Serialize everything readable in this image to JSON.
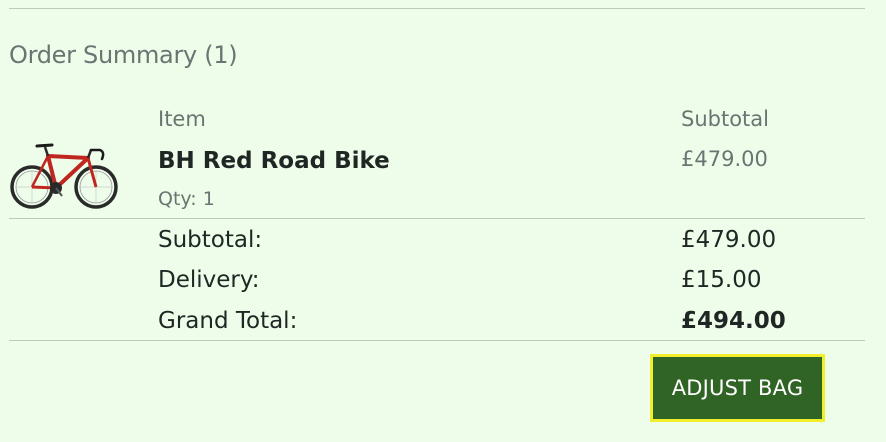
{
  "order_summary": {
    "title": "Order Summary (1)",
    "columns": {
      "item": "Item",
      "subtotal": "Subtotal"
    },
    "items": [
      {
        "name": "BH Red Road Bike",
        "qty": "Qty: 1",
        "subtotal": "£479.00",
        "image_icon": "red-road-bike"
      }
    ],
    "totals": {
      "subtotal_label": "Subtotal:",
      "subtotal_value": "£479.00",
      "delivery_label": "Delivery:",
      "delivery_value": "£15.00",
      "grand_total_label": "Grand Total:",
      "grand_total_value": "£494.00"
    },
    "adjust_button_label": "ADJUST BAG"
  },
  "colors": {
    "background": "#edfdea",
    "button_bg": "#2f6424",
    "button_border": "#f1ee2c",
    "muted_text": "#6b7472",
    "dark_text": "#1f2623"
  }
}
